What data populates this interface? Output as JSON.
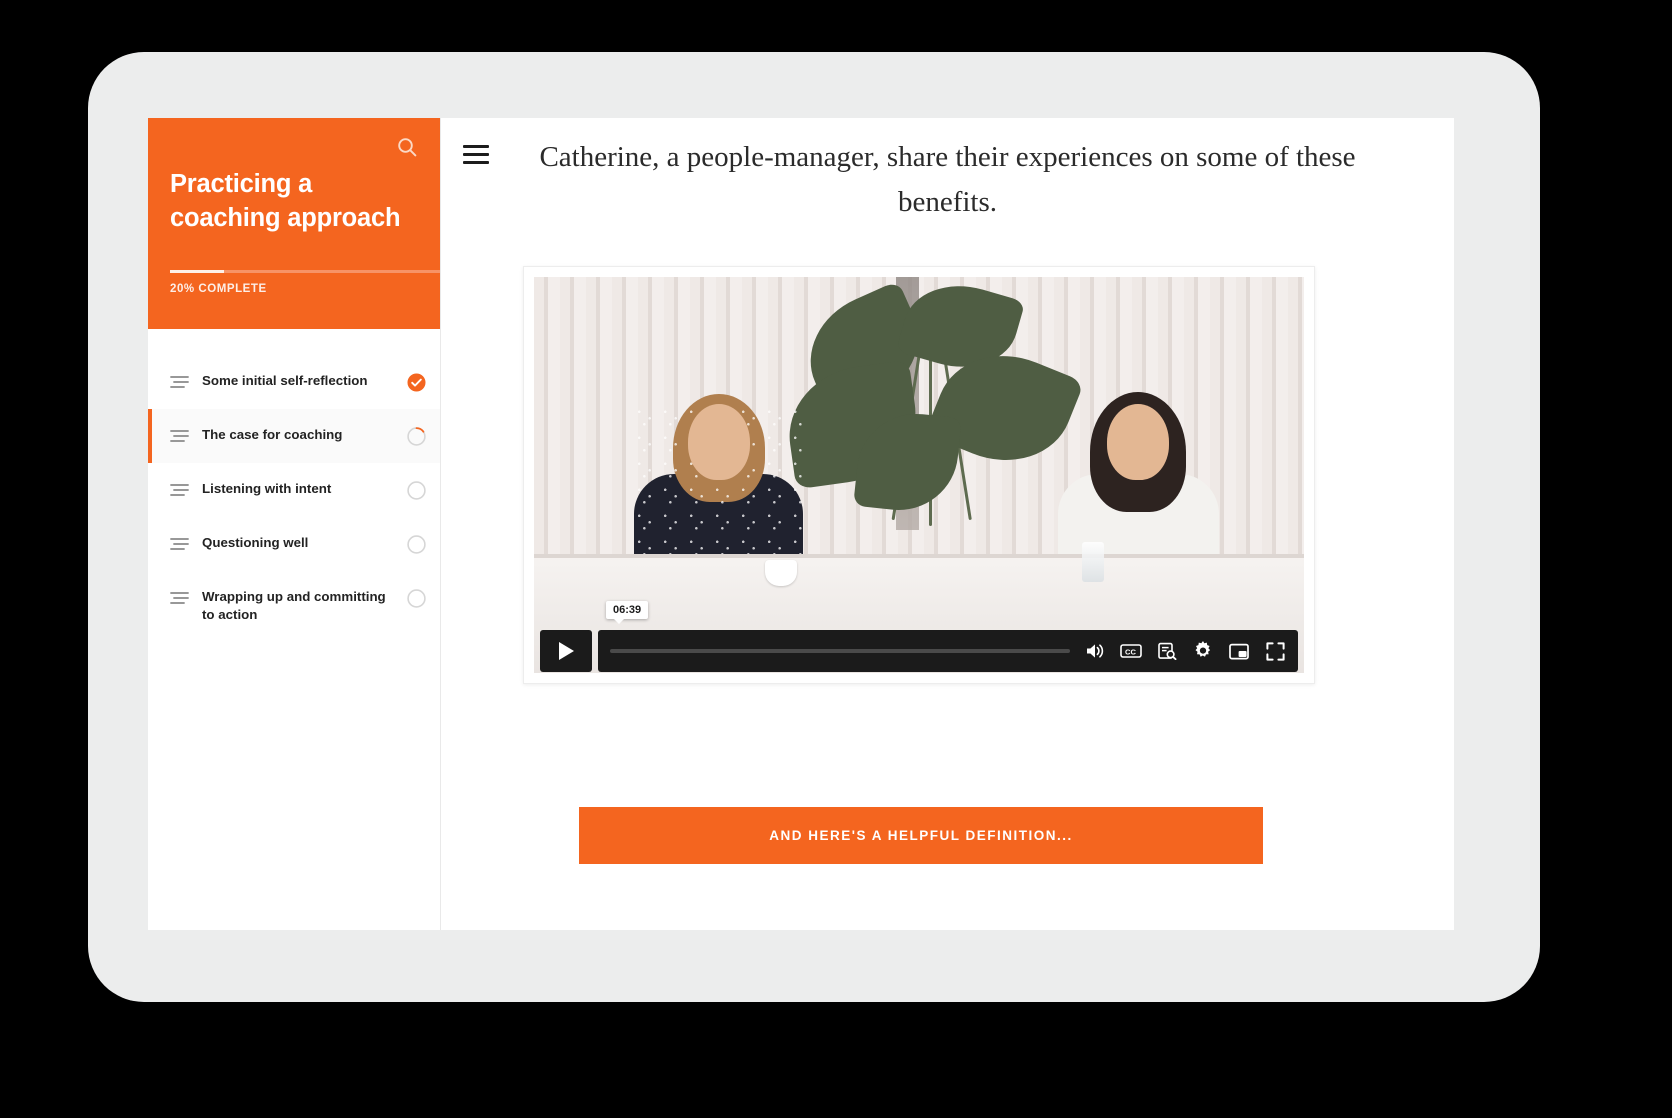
{
  "theme": {
    "accent": "#f4651f",
    "bezel": "#eceded",
    "background": "#000000"
  },
  "sidebar": {
    "search_icon": "search-icon",
    "course_title": "Practicing a coaching approach",
    "progress": {
      "percent": 20,
      "label": "20% COMPLETE"
    },
    "lessons": [
      {
        "label": "Some initial self-reflection",
        "status": "complete",
        "active": false
      },
      {
        "label": "The case for coaching",
        "status": "in-progress",
        "active": true
      },
      {
        "label": "Listening with intent",
        "status": "not-started",
        "active": false
      },
      {
        "label": "Questioning well",
        "status": "not-started",
        "active": false
      },
      {
        "label": "Wrapping up and committing to action",
        "status": "not-started",
        "active": false
      }
    ]
  },
  "main": {
    "menu_icon": "hamburger-menu-icon",
    "lead_paragraph": "Catherine, a people-manager, share their experiences on some of these benefits.",
    "video": {
      "current_time": "06:39",
      "progress_percent": 0,
      "play_label": "play-icon",
      "controls": [
        {
          "name": "volume-icon"
        },
        {
          "name": "closed-captions-icon"
        },
        {
          "name": "transcript-search-icon"
        },
        {
          "name": "settings-gear-icon"
        },
        {
          "name": "picture-in-picture-icon"
        },
        {
          "name": "fullscreen-icon"
        }
      ]
    },
    "cta_label": "AND HERE'S A HELPFUL DEFINITION..."
  }
}
